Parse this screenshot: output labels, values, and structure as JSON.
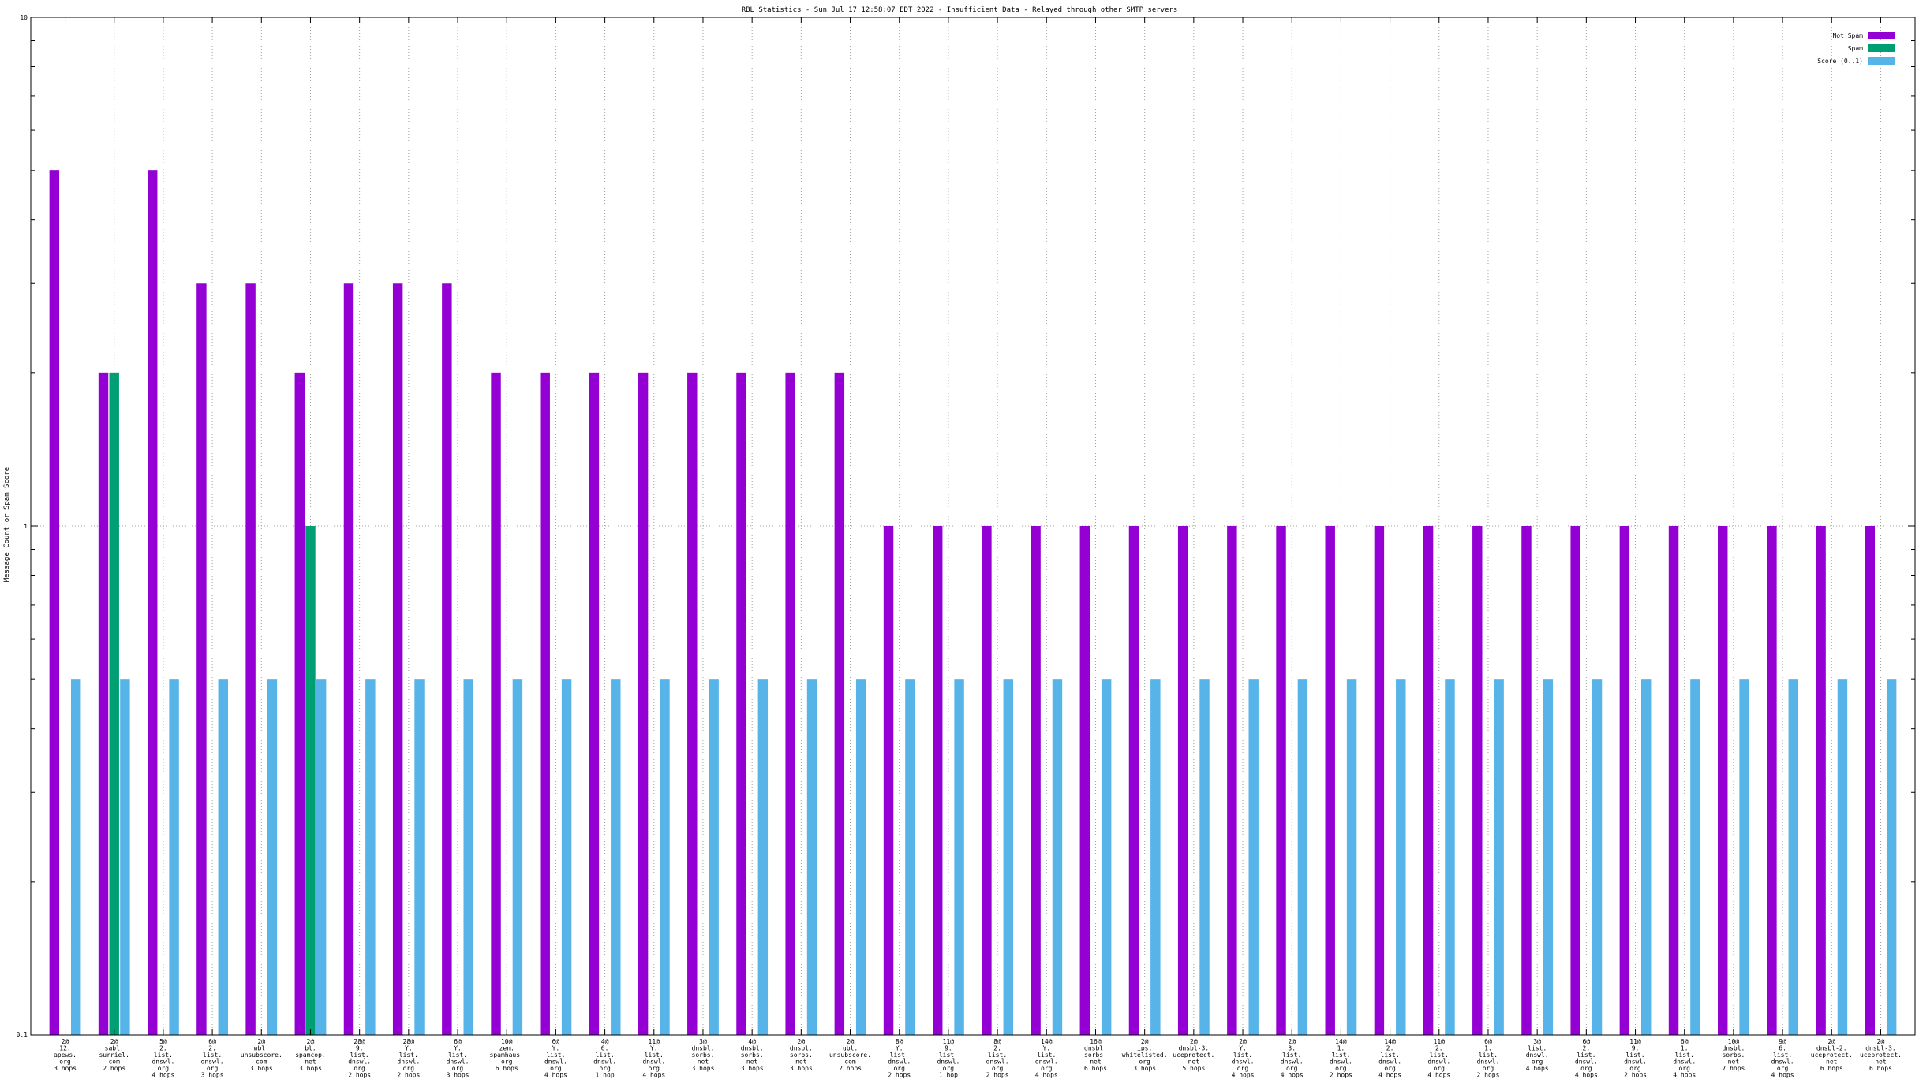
{
  "chart_data": {
    "type": "bar",
    "title": "RBL Statistics - Sun Jul 17 12:58:07 EDT 2022 - Insufficient Data - Relayed through other SMTP servers",
    "xlabel": "",
    "ylabel": "Message Count or Spam Score",
    "yscale": "log",
    "ylim": [
      0.1,
      10
    ],
    "yticks": [
      {
        "value": 0.1,
        "label": "0.1"
      },
      {
        "value": 1,
        "label": "1"
      },
      {
        "value": 10,
        "label": "10"
      }
    ],
    "grid": true,
    "legend_position": "top-right",
    "categories": [
      "2@ 12. apews. org 3 hops",
      "2@ sabl. surriel. com 2 hops",
      "5@ 2. list. dnswl. org 4 hops",
      "6@ 2. list. dnswl. org 3 hops",
      "2@ wbl. unsubscore. com 3 hops",
      "2@ bl. spamcop. net 3 hops",
      "28@ 9. list. dnswl. org 2 hops",
      "28@ Y. list. dnswl. org 2 hops",
      "6@ Y. list. dnswl. org 3 hops",
      "10@ zen. spamhaus. org 6 hops",
      "6@ Y. list. dnswl. org 4 hops",
      "4@ 6. list. dnswl. org 1 hop",
      "11@ Y. list. dnswl. org 4 hops",
      "3@ dnsbl. sorbs. net 3 hops",
      "4@ dnsbl. sorbs. net 3 hops",
      "2@ dnsbl. sorbs. net 3 hops",
      "2@ ubl. unsubscore. com 2 hops",
      "8@ Y. list. dnswl. org 2 hops",
      "11@ 9. list. dnswl. org 1 hop",
      "8@ 2. list. dnswl. org 2 hops",
      "14@ Y. list. dnswl. org 4 hops",
      "16@ dnsbl. sorbs. net 6 hops",
      "2@ ips. whitelisted. org 3 hops",
      "2@ dnsbl-3. uceprotect. net 5 hops",
      "2@ Y. list. dnswl. org 4 hops",
      "2@ 3. list. dnswl. org 4 hops",
      "14@ 1. list. dnswl. org 2 hops",
      "14@ 2. list. dnswl. org 4 hops",
      "11@ 2. list. dnswl. org 4 hops",
      "6@ 1. list. dnswl. org 2 hops",
      "3@ list. dnswl. org 4 hops",
      "6@ 2. list. dnswl. org 4 hops",
      "11@ 9. list. dnswl. org 2 hops",
      "6@ 1. list. dnswl. org 4 hops",
      "10@ dnsbl. sorbs. net 7 hops",
      "9@ 6. list. dnswl. org 4 hops",
      "2@ dnsbl-2. uceprotect. net 6 hops",
      "2@ dnsbl-3. uceprotect. net 6 hops"
    ],
    "series": [
      {
        "name": "Not Spam",
        "color": "#9400d3",
        "values": [
          5,
          2,
          5,
          3,
          3,
          2,
          3,
          3,
          3,
          2,
          2,
          2,
          2,
          2,
          2,
          2,
          2,
          1,
          1,
          1,
          1,
          1,
          1,
          1,
          1,
          1,
          1,
          1,
          1,
          1,
          1,
          1,
          1,
          1,
          1,
          1,
          1,
          1
        ]
      },
      {
        "name": "Spam",
        "color": "#009e73",
        "values": [
          null,
          2,
          null,
          null,
          null,
          1,
          null,
          null,
          null,
          null,
          null,
          null,
          null,
          null,
          null,
          null,
          null,
          null,
          null,
          null,
          null,
          null,
          null,
          null,
          null,
          null,
          null,
          null,
          null,
          null,
          null,
          null,
          null,
          null,
          null,
          null,
          null,
          null
        ]
      },
      {
        "name": "Score (0..1)",
        "color": "#56b4e9",
        "values": [
          0.5,
          0.5,
          0.5,
          0.5,
          0.5,
          0.5,
          0.5,
          0.5,
          0.5,
          0.5,
          0.5,
          0.5,
          0.5,
          0.5,
          0.5,
          0.5,
          0.5,
          0.5,
          0.5,
          0.5,
          0.5,
          0.5,
          0.5,
          0.5,
          0.5,
          0.5,
          0.5,
          0.5,
          0.5,
          0.5,
          0.5,
          0.5,
          0.5,
          0.5,
          0.5,
          0.5,
          0.5,
          0.5
        ]
      }
    ]
  }
}
